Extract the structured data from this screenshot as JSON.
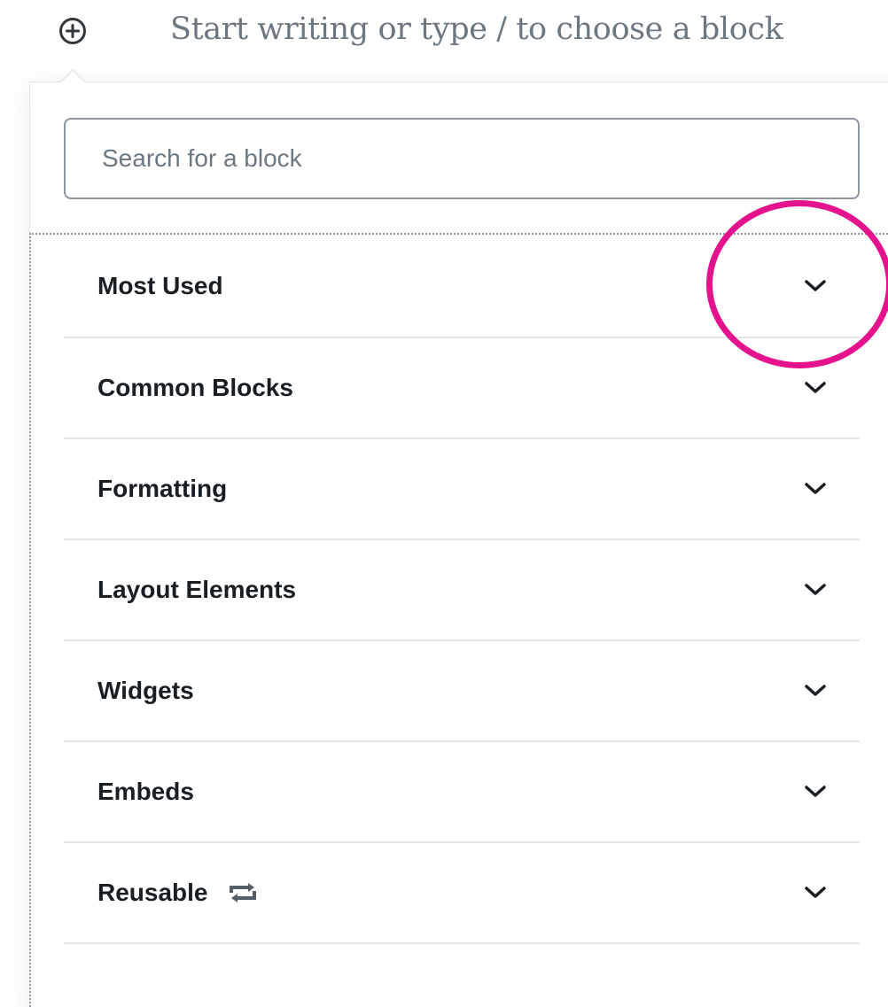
{
  "editor": {
    "placeholder": "Start writing or type / to choose a block",
    "inserter_icon": "plus-circle-icon"
  },
  "inserter": {
    "search": {
      "placeholder": "Search for a block",
      "value": ""
    },
    "panels": [
      {
        "label": "Most Used",
        "icon": "chevron-down-icon"
      },
      {
        "label": "Common Blocks",
        "icon": "chevron-down-icon"
      },
      {
        "label": "Formatting",
        "icon": "chevron-down-icon"
      },
      {
        "label": "Layout Elements",
        "icon": "chevron-down-icon"
      },
      {
        "label": "Widgets",
        "icon": "chevron-down-icon"
      },
      {
        "label": "Embeds",
        "icon": "chevron-down-icon"
      },
      {
        "label": "Reusable",
        "icon": "chevron-down-icon",
        "extra_icon": "reusable-arrows-icon"
      }
    ]
  },
  "annotation": {
    "color": "#e5128d",
    "target": "chevron-down-icon"
  },
  "colors": {
    "text": "#191e23",
    "placeholder": "#6c7781",
    "border": "#8d96a0",
    "divider": "#e2e4e7"
  }
}
